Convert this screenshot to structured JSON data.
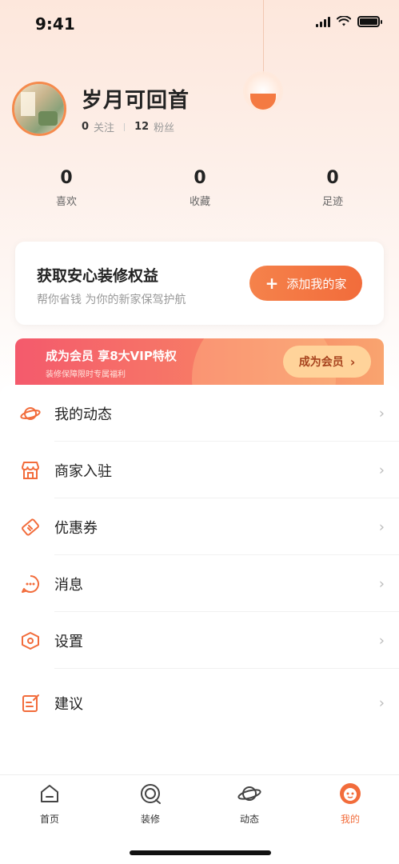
{
  "status_bar": {
    "time": "9:41"
  },
  "profile": {
    "name": "岁月可回首",
    "following_count": "0",
    "following_label": "关注",
    "fans_count": "12",
    "fans_label": "粉丝"
  },
  "stats": [
    {
      "value": "0",
      "label": "喜欢"
    },
    {
      "value": "0",
      "label": "收藏"
    },
    {
      "value": "0",
      "label": "足迹"
    }
  ],
  "promo_card": {
    "title": "获取安心装修权益",
    "subtitle": "帮你省钱  为你的新家保驾护航",
    "button_label": "添加我的家"
  },
  "vip_banner": {
    "title": "成为会员  享8大VIP特权",
    "subtitle": "装修保障限时专属福利",
    "button_label": "成为会员"
  },
  "menu": [
    {
      "label": "我的动态",
      "icon": "planet-icon"
    },
    {
      "label": "商家入驻",
      "icon": "store-icon"
    },
    {
      "label": "优惠券",
      "icon": "coupon-icon"
    },
    {
      "label": "消息",
      "icon": "message-icon"
    },
    {
      "label": "设置",
      "icon": "settings-icon"
    },
    {
      "label": "建议",
      "icon": "feedback-icon"
    }
  ],
  "tabbar": [
    {
      "label": "首页",
      "icon": "home-icon"
    },
    {
      "label": "装修",
      "icon": "decorate-icon"
    },
    {
      "label": "动态",
      "icon": "planet-icon"
    },
    {
      "label": "我的",
      "icon": "profile-face-icon",
      "active": true
    }
  ],
  "colors": {
    "accent": "#f26c3b",
    "vip_gradient_start": "#f45a6c",
    "vip_button": "#ffd39a"
  }
}
